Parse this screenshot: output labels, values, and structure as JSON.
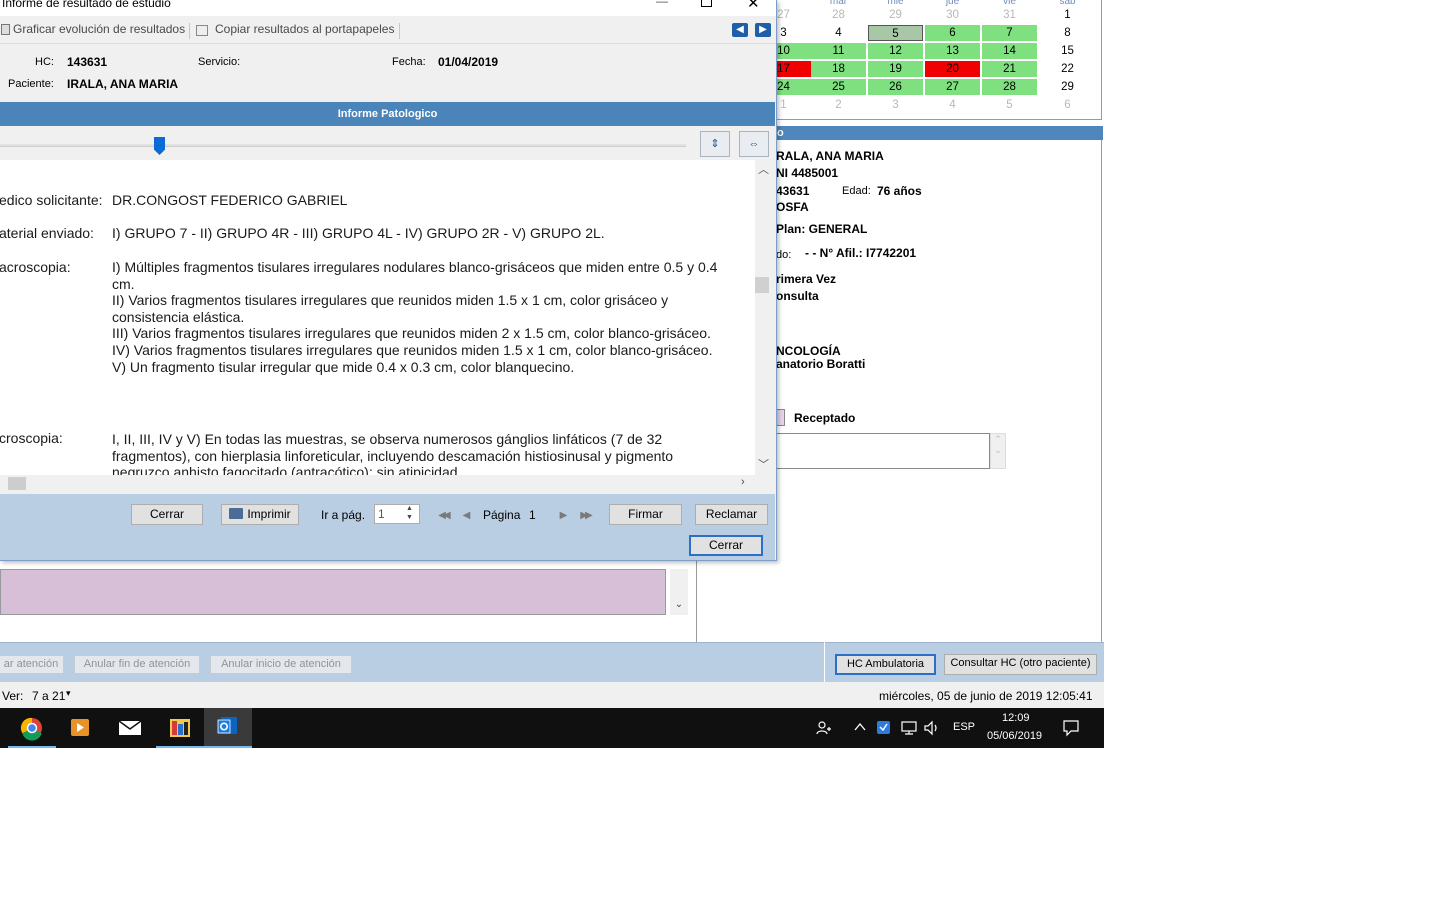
{
  "dialog": {
    "title": "Informe de resultado de estudio",
    "toolbar": {
      "graph_label": "Graficar evolución de resultados",
      "copy_label": "Copiar resultados al portapapeles"
    },
    "info": {
      "hc_label": "HC:",
      "hc_value": "143631",
      "servicio_label": "Servicio:",
      "fecha_label": "Fecha:",
      "fecha_value": "01/04/2019",
      "paciente_label": "Paciente:",
      "paciente_value": "IRALA, ANA MARIA"
    },
    "report_title": "Informe Patologico",
    "document": {
      "fields": [
        {
          "label": "edico solicitante:",
          "text": "DR.CONGOST FEDERICO GABRIEL"
        },
        {
          "label": "aterial enviado:",
          "text": "I) GRUPO 7 - II) GRUPO 4R - III) GRUPO 4L - IV) GRUPO 2R - V) GRUPO 2L."
        },
        {
          "label": "acroscopia:",
          "text": "I) Múltiples fragmentos tisulares irregulares nodulares blanco-grisáceos que miden entre 0.5 y 0.4 cm.\nII) Varios fragmentos tisulares irregulares que reunidos miden 1.5 x 1 cm, color grisáceo y consistencia elástica.\nIII) Varios fragmentos tisulares irregulares que reunidos miden 2 x 1.5 cm, color blanco-grisáceo.\nIV) Varios fragmentos tisulares irregulares que reunidos miden 1.5 x 1 cm, color blanco-grisáceo.\nV) Un fragmento tisular irregular que mide 0.4 x 0.3 cm, color blanquecino."
        },
        {
          "label": "croscopia:",
          "text": "I, II, III, IV y V) En todas las muestras, se observa numerosos gánglios linfáticos (7 de 32 fragmentos), con hierplasia linforeticular, incluyendo descamación histiosinusal y pigmento negruzco anhisto fagocitado (antracótico); sin atipicidad."
        }
      ]
    },
    "footer": {
      "cerrar_label": "Cerrar",
      "imprimir_label": "Imprimir",
      "goto_label": "Ir a pág.",
      "goto_value": "1",
      "pagina_label": "Página",
      "pagina_value": "1",
      "firmar_label": "Firmar",
      "reclamar_label": "Reclamar",
      "cerrar2_label": "Cerrar"
    }
  },
  "calendar": {
    "days_of_week": [
      "",
      "mar",
      "mie",
      "jue",
      "vie",
      "sab"
    ],
    "weeks": [
      [
        {
          "d": "27",
          "s": "gray"
        },
        {
          "d": "28",
          "s": "gray"
        },
        {
          "d": "29",
          "s": "gray"
        },
        {
          "d": "30",
          "s": "gray"
        },
        {
          "d": "31",
          "s": "gray"
        },
        {
          "d": "1",
          "s": ""
        }
      ],
      [
        {
          "d": "3",
          "s": ""
        },
        {
          "d": "4",
          "s": ""
        },
        {
          "d": "5",
          "s": "sel"
        },
        {
          "d": "6",
          "s": "green"
        },
        {
          "d": "7",
          "s": "green"
        },
        {
          "d": "8",
          "s": ""
        }
      ],
      [
        {
          "d": "10",
          "s": "green"
        },
        {
          "d": "11",
          "s": "green"
        },
        {
          "d": "12",
          "s": "green"
        },
        {
          "d": "13",
          "s": "green"
        },
        {
          "d": "14",
          "s": "green"
        },
        {
          "d": "15",
          "s": ""
        }
      ],
      [
        {
          "d": "17",
          "s": "red"
        },
        {
          "d": "18",
          "s": "green"
        },
        {
          "d": "19",
          "s": "green"
        },
        {
          "d": "20",
          "s": "red"
        },
        {
          "d": "21",
          "s": "green"
        },
        {
          "d": "22",
          "s": ""
        }
      ],
      [
        {
          "d": "24",
          "s": "green"
        },
        {
          "d": "25",
          "s": "green"
        },
        {
          "d": "26",
          "s": "green"
        },
        {
          "d": "27",
          "s": "green"
        },
        {
          "d": "28",
          "s": "green"
        },
        {
          "d": "29",
          "s": ""
        }
      ],
      [
        {
          "d": "1",
          "s": "gray"
        },
        {
          "d": "2",
          "s": "gray"
        },
        {
          "d": "3",
          "s": "gray"
        },
        {
          "d": "4",
          "s": "gray"
        },
        {
          "d": "5",
          "s": "gray"
        },
        {
          "d": "6",
          "s": "gray"
        }
      ]
    ]
  },
  "patient_panel": {
    "header": "o",
    "name": "RALA, ANA MARIA",
    "dni": "NI 4485001",
    "hc": "43631",
    "edad_label": "Edad:",
    "edad_value": "76 años",
    "obra_social": "OSFA",
    "plan": "Plan: GENERAL",
    "afil_label": "do:",
    "afil_value": "- - N° Afil.: I7742201",
    "tipo1": "rimera Vez",
    "tipo2": "onsulta",
    "especialidad": "NCOLOGÍA",
    "lugar": "anatorio Boratti",
    "estado": "Receptado"
  },
  "action_bar": {
    "btn1": "ar atención",
    "btn2": "Anular fin de atención",
    "btn3": "Anular inicio de atención",
    "hc_amb": "HC Ambulatoria",
    "consultar": "Consultar HC (otro paciente)"
  },
  "status_bar": {
    "ver_label": "Ver:",
    "ver_value": "7 a 21",
    "datetime": "miércoles, 05 de junio de 2019  12:05:41"
  },
  "taskbar": {
    "lang": "ESP",
    "time": "12:09",
    "date": "05/06/2019"
  }
}
